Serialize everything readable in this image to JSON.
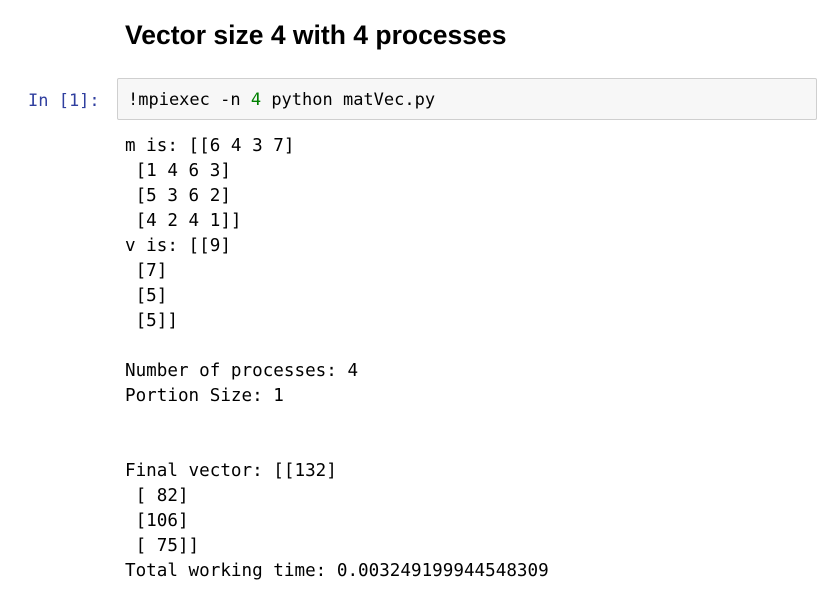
{
  "notebook": {
    "heading": "Vector size 4 with 4 processes",
    "cell": {
      "prompt": "In [1]:",
      "code_prefix": "!mpiexec -n ",
      "code_number": "4",
      "code_suffix": " python matVec.py",
      "output_lines": [
        "m is: [[6 4 3 7]",
        " [1 4 6 3]",
        " [5 3 6 2]",
        " [4 2 4 1]]",
        "v is: [[9]",
        " [7]",
        " [5]",
        " [5]]",
        "",
        "Number of processes: 4",
        "Portion Size: 1",
        "",
        "",
        "Final vector: [[132]",
        " [ 82]",
        " [106]",
        " [ 75]]",
        "Total working time: 0.003249199944548309"
      ]
    }
  }
}
